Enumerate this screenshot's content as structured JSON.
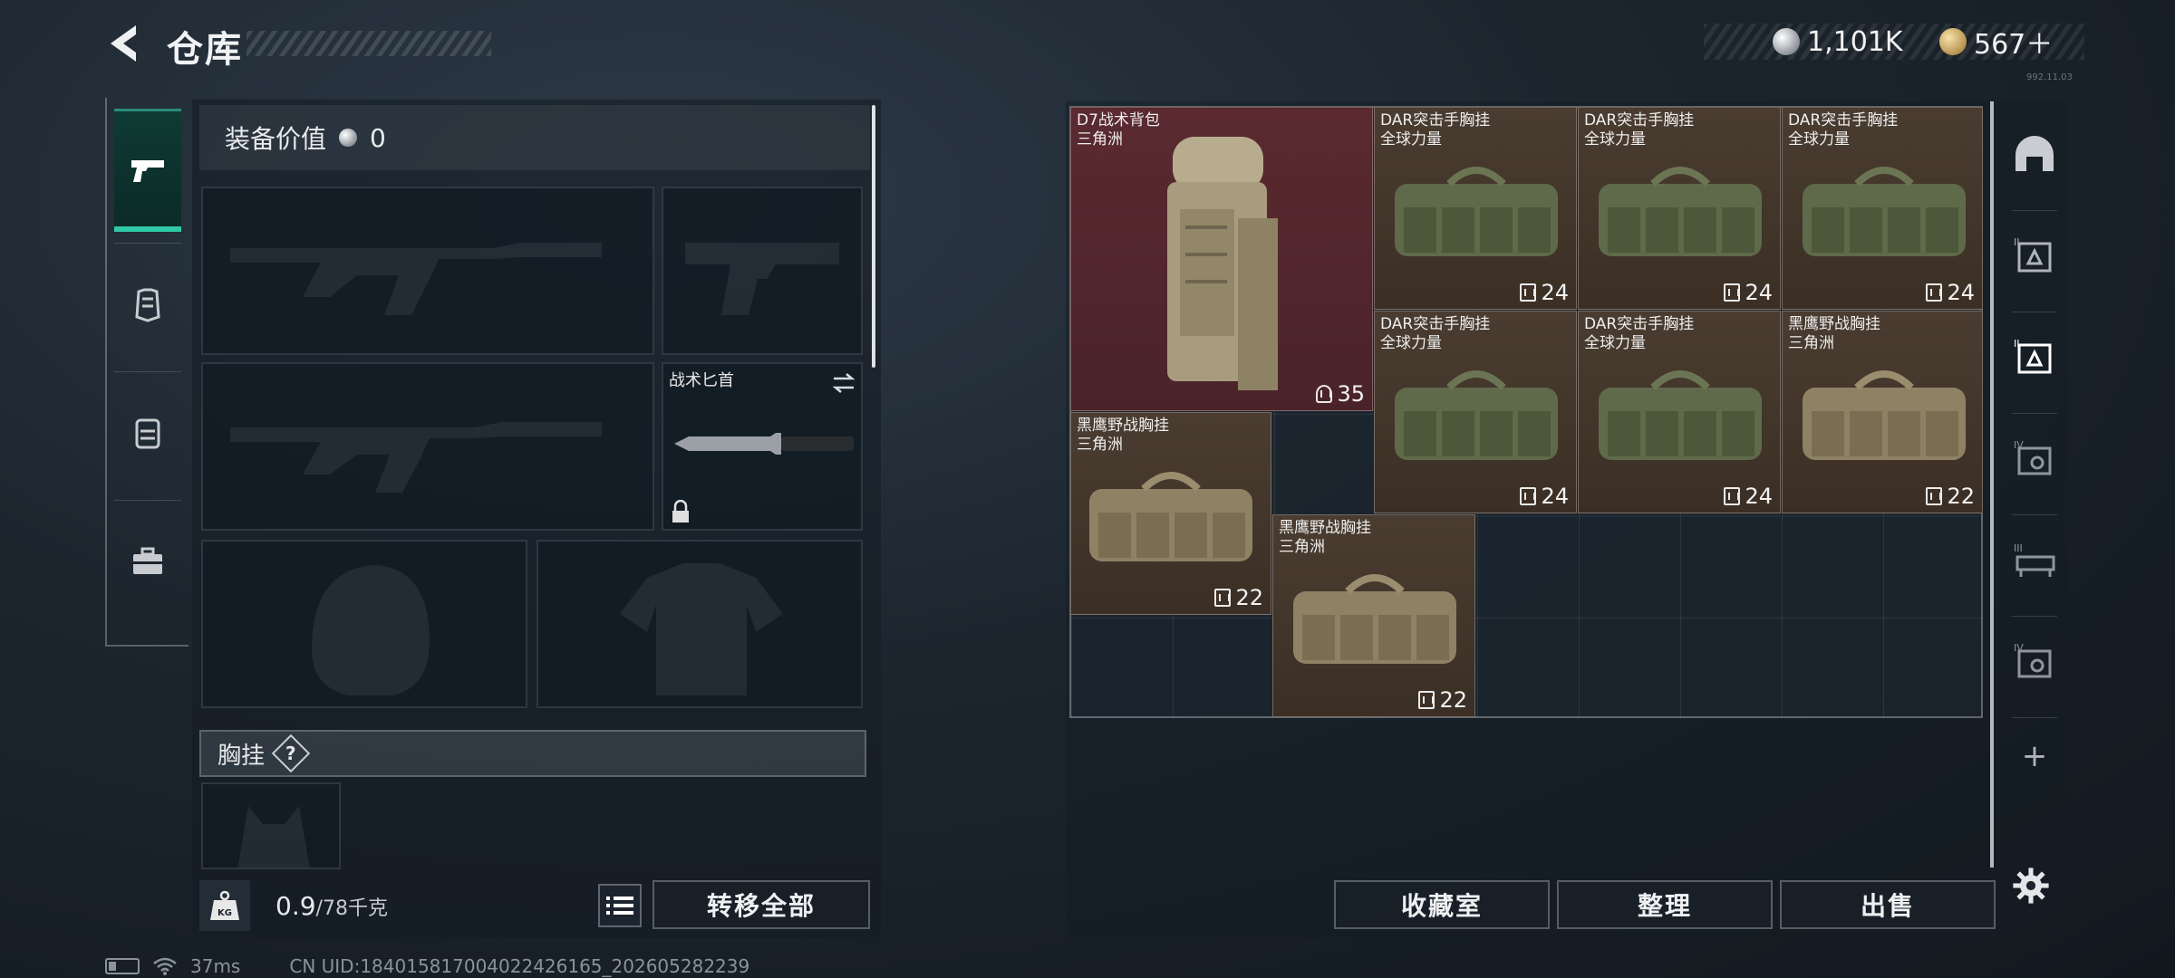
{
  "header": {
    "title": "仓库",
    "currency": [
      {
        "icon": "silver-coin-icon",
        "value": "1,101K"
      },
      {
        "icon": "gold-coin-icon",
        "value": "567＋"
      }
    ],
    "version": "992.11.03"
  },
  "left_nav": {
    "items": [
      {
        "icon": "pistol-icon",
        "active": true
      },
      {
        "icon": "armor-icon",
        "active": false
      },
      {
        "icon": "backpack-icon",
        "active": false
      },
      {
        "icon": "briefcase-icon",
        "active": false
      }
    ]
  },
  "loadout": {
    "value_label": "装备价值",
    "value": "0",
    "knife_label": "战术匕首",
    "chest_rig_label": "胸挂",
    "chest_rig_help": "?",
    "weight_current": "0.9",
    "weight_max": "/78千克",
    "transfer_all": "转移全部"
  },
  "stash_items": [
    {
      "name": "D7战术背包",
      "sub": "三角洲",
      "cap": "35",
      "kind": "backpack"
    },
    {
      "name": "DAR突击手胸挂",
      "sub": "全球力量",
      "cap": "24",
      "kind": "rig-green"
    },
    {
      "name": "DAR突击手胸挂",
      "sub": "全球力量",
      "cap": "24",
      "kind": "rig-green"
    },
    {
      "name": "DAR突击手胸挂",
      "sub": "全球力量",
      "cap": "24",
      "kind": "rig-green"
    },
    {
      "name": "DAR突击手胸挂",
      "sub": "全球力量",
      "cap": "24",
      "kind": "rig-green"
    },
    {
      "name": "DAR突击手胸挂",
      "sub": "全球力量",
      "cap": "24",
      "kind": "rig-green"
    },
    {
      "name": "黑鹰野战胸挂",
      "sub": "三角洲",
      "cap": "22",
      "kind": "rig-tan"
    },
    {
      "name": "黑鹰野战胸挂",
      "sub": "三角洲",
      "cap": "22",
      "kind": "rig-tan"
    },
    {
      "name": "黑鹰野战胸挂",
      "sub": "三角洲",
      "cap": "22",
      "kind": "rig-tan"
    }
  ],
  "right_tabs": [
    {
      "icon": "dome-icon"
    },
    {
      "icon": "stash-tier-ii-icon"
    },
    {
      "icon": "stash-tier-ii-active-icon"
    },
    {
      "icon": "stash-tier-iv-icon"
    },
    {
      "icon": "stash-tier-iii-icon"
    },
    {
      "icon": "stash-tier-iv-b-icon"
    },
    {
      "icon": "add-icon",
      "label": "+"
    },
    {
      "icon": "settings-icon"
    }
  ],
  "actions": {
    "collection": "收藏室",
    "organize": "整理",
    "sell": "出售"
  },
  "status_bar": {
    "ping": "37ms",
    "uid": "CN UID:184015817004022426165_202605282239"
  },
  "colors": {
    "accent": "#30c8a6",
    "item_brown": "#4a3c30",
    "item_red": "#5a2a30"
  }
}
